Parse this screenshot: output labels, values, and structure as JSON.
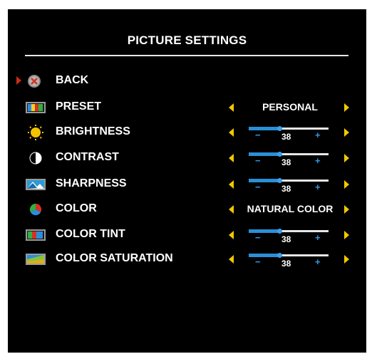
{
  "menu": {
    "title": "PICTURE SETTINGS",
    "items": [
      {
        "label": "BACK",
        "icon": "back-icon"
      },
      {
        "label": "PRESET",
        "icon": "preset-icon",
        "value": "PERSONAL"
      },
      {
        "label": "BRIGHTNESS",
        "icon": "brightness-icon",
        "level": "38",
        "minus": "−",
        "plus": "+"
      },
      {
        "label": "CONTRAST",
        "icon": "contrast-icon",
        "level": "38",
        "minus": "−",
        "plus": "+"
      },
      {
        "label": "SHARPNESS",
        "icon": "sharpness-icon",
        "level": "38",
        "minus": "−",
        "plus": "+"
      },
      {
        "label": "COLOR",
        "icon": "color-icon",
        "value": "NATURAL COLOR"
      },
      {
        "label": "COLOR TINT",
        "icon": "color-tint-icon",
        "level": "38",
        "minus": "−",
        "plus": "+"
      },
      {
        "label": "COLOR SATURATION",
        "icon": "color-saturation-icon",
        "level": "38",
        "minus": "−",
        "plus": "+"
      }
    ]
  },
  "colors": {
    "background": "#000000",
    "text": "#ffffff",
    "arrow": "#f0c800",
    "slider": "#2a8fd8",
    "selection": "#cc2a1a"
  }
}
